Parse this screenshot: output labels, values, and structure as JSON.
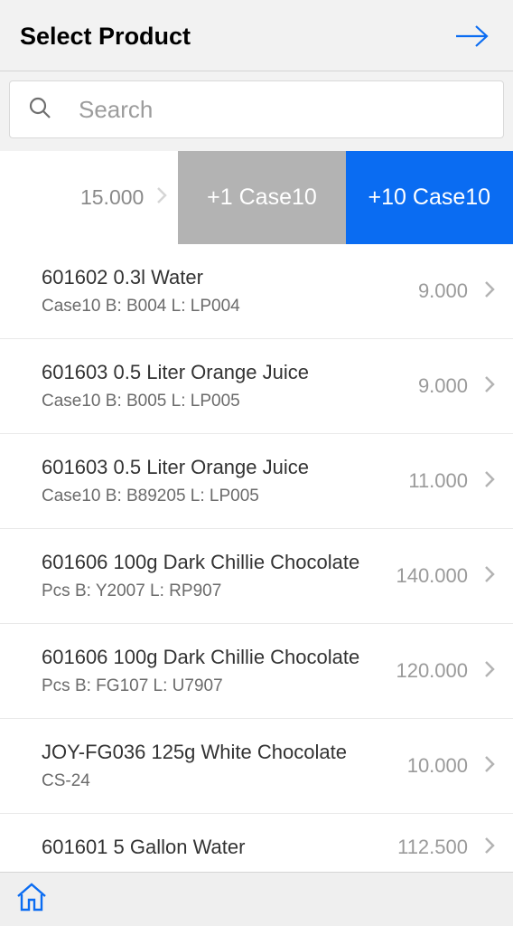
{
  "header": {
    "title": "Select Product"
  },
  "search": {
    "placeholder": "Search"
  },
  "qty_bar": {
    "value": "15.000",
    "plus1": "+1 Case10",
    "plus10": "+10 Case10"
  },
  "rows": [
    {
      "title": "601602 0.3l Water",
      "sub": "Case10 B: B004 L: LP004",
      "qty": "9.000"
    },
    {
      "title": "601603 0.5 Liter Orange Juice",
      "sub": "Case10 B: B005 L: LP005",
      "qty": "9.000"
    },
    {
      "title": "601603 0.5 Liter Orange Juice",
      "sub": "Case10 B: B89205 L: LP005",
      "qty": "11.000"
    },
    {
      "title": "601606 100g Dark Chillie Chocolate",
      "sub": "Pcs B: Y2007 L: RP907",
      "qty": "140.000"
    },
    {
      "title": "601606 100g Dark Chillie Chocolate",
      "sub": "Pcs B: FG107 L: U7907",
      "qty": "120.000"
    },
    {
      "title": "JOY-FG036 125g White Chocolate",
      "sub": "CS-24",
      "qty": "10.000"
    },
    {
      "title": "601601 5 Gallon Water",
      "sub": "",
      "qty": "112.500"
    }
  ]
}
